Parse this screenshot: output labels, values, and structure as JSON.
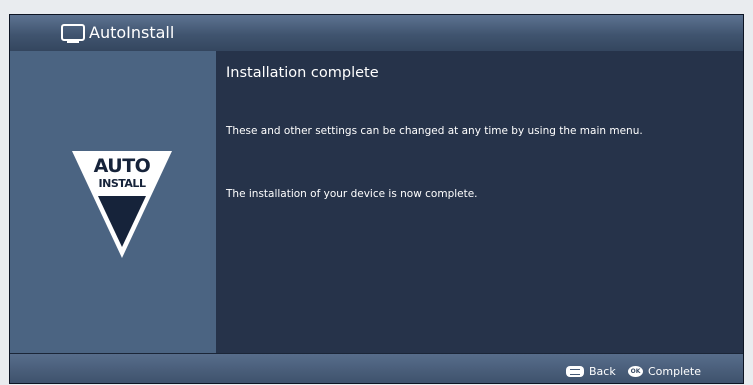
{
  "header": {
    "title": "AutoInstall",
    "icon": "tv-icon"
  },
  "logo": {
    "line1": "AUTO",
    "line2": "INSTALL"
  },
  "main": {
    "title": "Installation complete",
    "paragraphs": [
      "These and other settings can be changed at any time by using the main menu.",
      "The installation of your device is now complete."
    ]
  },
  "footer": {
    "back_label": "Back",
    "ok_key_glyph": "OK",
    "complete_label": "Complete"
  },
  "colors": {
    "background": "#26334a",
    "title_bar": "#4a5f7d",
    "left_panel": "#4b6482",
    "text": "#ffffff",
    "logo_fill": "#ffffff",
    "logo_ink": "#16233a"
  }
}
